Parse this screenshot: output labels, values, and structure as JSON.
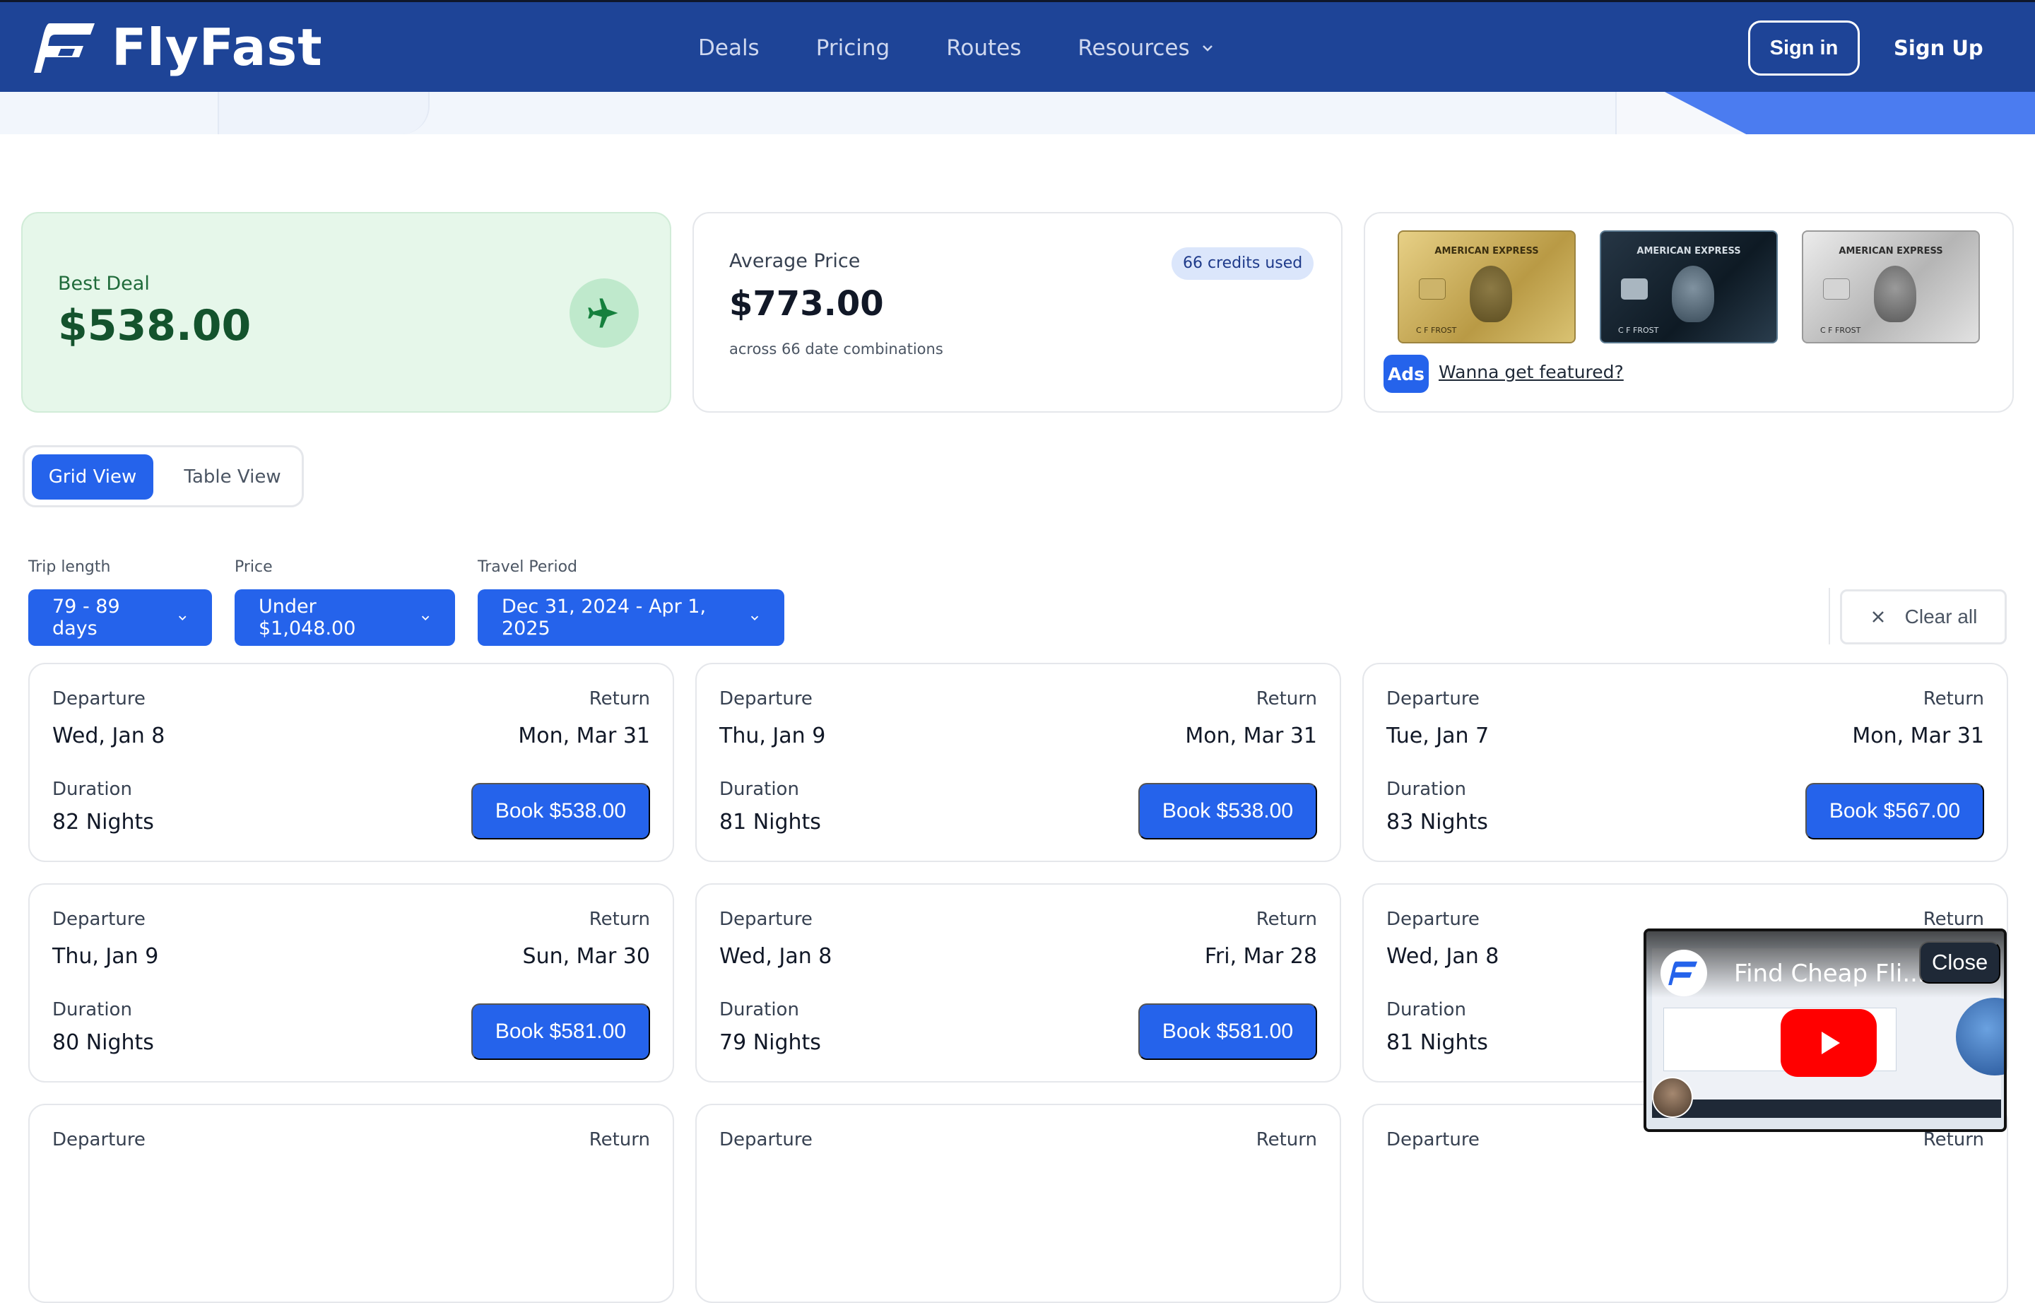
{
  "brand": {
    "name": "FlyFast"
  },
  "nav": {
    "items": [
      {
        "label": "Deals"
      },
      {
        "label": "Pricing"
      },
      {
        "label": "Routes"
      },
      {
        "label": "Resources"
      }
    ],
    "signin": "Sign in",
    "signup": "Sign Up"
  },
  "stats": {
    "best_label": "Best Deal",
    "best_value": "$538.00",
    "avg_label": "Average Price",
    "avg_value": "$773.00",
    "avg_sub": "across 66 date combinations",
    "credits": "66 credits used"
  },
  "ads": {
    "cards": [
      {
        "brand": "AMERICAN EXPRESS",
        "holder": "C F FROST"
      },
      {
        "brand": "AMERICAN EXPRESS",
        "holder": "C F FROST"
      },
      {
        "brand": "AMERICAN EXPRESS",
        "holder": "C F FROST"
      }
    ],
    "badge": "Ads",
    "link": "Wanna get featured?"
  },
  "view": {
    "grid": "Grid View",
    "table": "Table View",
    "active": "grid"
  },
  "filters": {
    "trip_label": "Trip length",
    "trip_value": "79 - 89 days",
    "price_label": "Price",
    "price_value": "Under $1,048.00",
    "period_label": "Travel Period",
    "period_value": "Dec 31, 2024 - Apr 1, 2025",
    "clear": "Clear all"
  },
  "labels": {
    "departure": "Departure",
    "return": "Return",
    "duration": "Duration"
  },
  "deals": [
    {
      "dep": "Wed, Jan 8",
      "ret": "Mon, Mar 31",
      "nights": "82 Nights",
      "book": "Book $538.00"
    },
    {
      "dep": "Thu, Jan 9",
      "ret": "Mon, Mar 31",
      "nights": "81 Nights",
      "book": "Book $538.00"
    },
    {
      "dep": "Tue, Jan 7",
      "ret": "Mon, Mar 31",
      "nights": "83 Nights",
      "book": "Book $567.00"
    },
    {
      "dep": "Thu, Jan 9",
      "ret": "Sun, Mar 30",
      "nights": "80 Nights",
      "book": "Book $581.00"
    },
    {
      "dep": "Wed, Jan 8",
      "ret": "Fri, Mar 28",
      "nights": "79 Nights",
      "book": "Book $581.00"
    },
    {
      "dep": "Wed, Jan 8",
      "ret": "",
      "nights": "81 Nights",
      "book": ""
    }
  ],
  "partial_row": {
    "dep_label": "Departure",
    "ret_label": "Return"
  },
  "video": {
    "title": "Find Cheap Fli...",
    "close": "Close"
  },
  "colors": {
    "primary": "#2563eb",
    "header": "#1e4497",
    "success_bg": "#e6f7ea",
    "success_text": "#14532d"
  }
}
